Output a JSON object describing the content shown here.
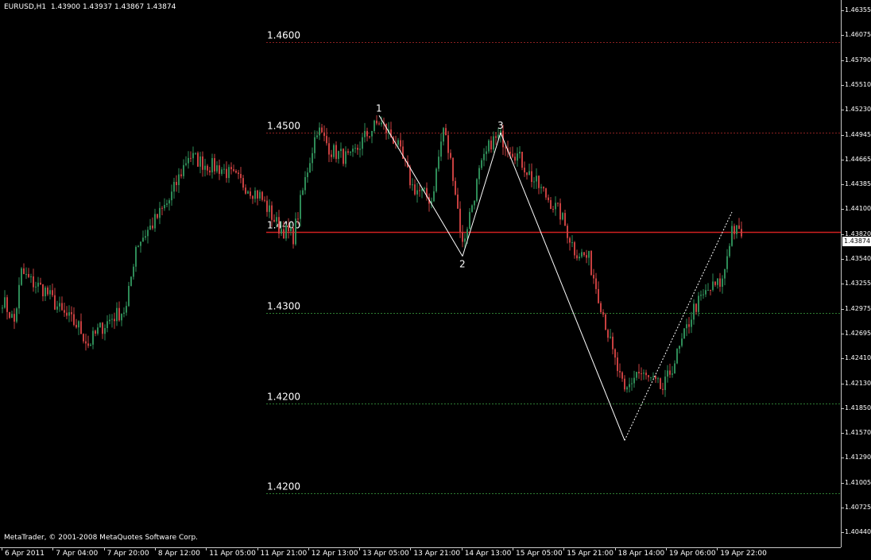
{
  "header": {
    "symbol": "EURUSD,H1",
    "ohlc": "1.43900 1.43937 1.43867 1.43874"
  },
  "copyright": "MetaTrader, © 2001-2008 MetaQuotes Software Corp.",
  "colors": {
    "background": "#000000",
    "bull_candle": "#2e8b57",
    "bear_candle": "#c84040",
    "support_level": "#2e7d32",
    "resistance_level": "#8b2020",
    "current_level": "#d02020",
    "pattern_line": "#ffffff"
  },
  "chart_data": {
    "type": "candlestick",
    "symbol": "EURUSD",
    "timeframe": "H1",
    "y_ticks": [
      "1.46355",
      "1.46075",
      "1.45790",
      "1.45510",
      "1.45230",
      "1.44945",
      "1.44665",
      "1.44385",
      "1.44100",
      "1.43820",
      "1.43540",
      "1.43255",
      "1.42975",
      "1.42695",
      "1.42410",
      "1.42130",
      "1.41850",
      "1.41570",
      "1.41290",
      "1.41005",
      "1.40725",
      "1.40440"
    ],
    "current_price": "1.43874",
    "x_ticks": [
      "6 Apr 2011",
      "7 Apr 04:00",
      "7 Apr 20:00",
      "8 Apr 12:00",
      "11 Apr 05:00",
      "11 Apr 21:00",
      "12 Apr 13:00",
      "13 Apr 05:00",
      "13 Apr 21:00",
      "14 Apr 13:00",
      "15 Apr 05:00",
      "15 Apr 21:00",
      "18 Apr 14:00",
      "19 Apr 06:00",
      "19 Apr 22:00"
    ],
    "levels": [
      {
        "label": "1.4600",
        "price": 1.46,
        "style": "dotted",
        "color": "resistance"
      },
      {
        "label": "1.4500",
        "price": 1.45,
        "style": "dotted",
        "color": "resistance"
      },
      {
        "label": "1.4400",
        "price": 1.439,
        "style": "solid",
        "color": "current"
      },
      {
        "label": "1.4300",
        "price": 1.43,
        "style": "dotted",
        "color": "support"
      },
      {
        "label": "1.4200",
        "price": 1.42,
        "style": "dotted",
        "color": "support"
      },
      {
        "label": "1.4200",
        "price": 1.41,
        "style": "dotted",
        "color": "support"
      }
    ],
    "pattern_points": [
      {
        "label": "1",
        "price": 1.4519,
        "bar": 158
      },
      {
        "label": "2",
        "price": 1.4363,
        "bar": 193
      },
      {
        "label": "3",
        "price": 1.45,
        "bar": 209
      },
      {
        "label": "",
        "price": 1.4159,
        "bar": 261
      },
      {
        "label": "",
        "price": 1.4412,
        "bar": 306
      }
    ],
    "anchors": [
      [
        0,
        1.4315
      ],
      [
        5,
        1.429
      ],
      [
        8,
        1.4345
      ],
      [
        12,
        1.4335
      ],
      [
        18,
        1.4325
      ],
      [
        25,
        1.43
      ],
      [
        32,
        1.4285
      ],
      [
        36,
        1.4265
      ],
      [
        40,
        1.428
      ],
      [
        46,
        1.4295
      ],
      [
        52,
        1.4305
      ],
      [
        56,
        1.4375
      ],
      [
        62,
        1.4395
      ],
      [
        70,
        1.4425
      ],
      [
        78,
        1.4475
      ],
      [
        85,
        1.4465
      ],
      [
        92,
        1.446
      ],
      [
        100,
        1.4445
      ],
      [
        108,
        1.443
      ],
      [
        116,
        1.4395
      ],
      [
        122,
        1.4385
      ],
      [
        128,
        1.446
      ],
      [
        132,
        1.4505
      ],
      [
        138,
        1.448
      ],
      [
        146,
        1.447
      ],
      [
        152,
        1.4495
      ],
      [
        158,
        1.4512
      ],
      [
        165,
        1.449
      ],
      [
        172,
        1.444
      ],
      [
        180,
        1.4425
      ],
      [
        185,
        1.4505
      ],
      [
        189,
        1.4455
      ],
      [
        193,
        1.4375
      ],
      [
        200,
        1.4455
      ],
      [
        205,
        1.449
      ],
      [
        209,
        1.4495
      ],
      [
        216,
        1.4475
      ],
      [
        222,
        1.445
      ],
      [
        228,
        1.443
      ],
      [
        234,
        1.441
      ],
      [
        240,
        1.437
      ],
      [
        246,
        1.436
      ],
      [
        252,
        1.43
      ],
      [
        256,
        1.4255
      ],
      [
        261,
        1.421
      ],
      [
        266,
        1.4235
      ],
      [
        272,
        1.4225
      ],
      [
        277,
        1.4215
      ],
      [
        284,
        1.426
      ],
      [
        290,
        1.4305
      ],
      [
        296,
        1.4325
      ],
      [
        302,
        1.4335
      ],
      [
        306,
        1.4395
      ],
      [
        310,
        1.4385
      ]
    ]
  }
}
